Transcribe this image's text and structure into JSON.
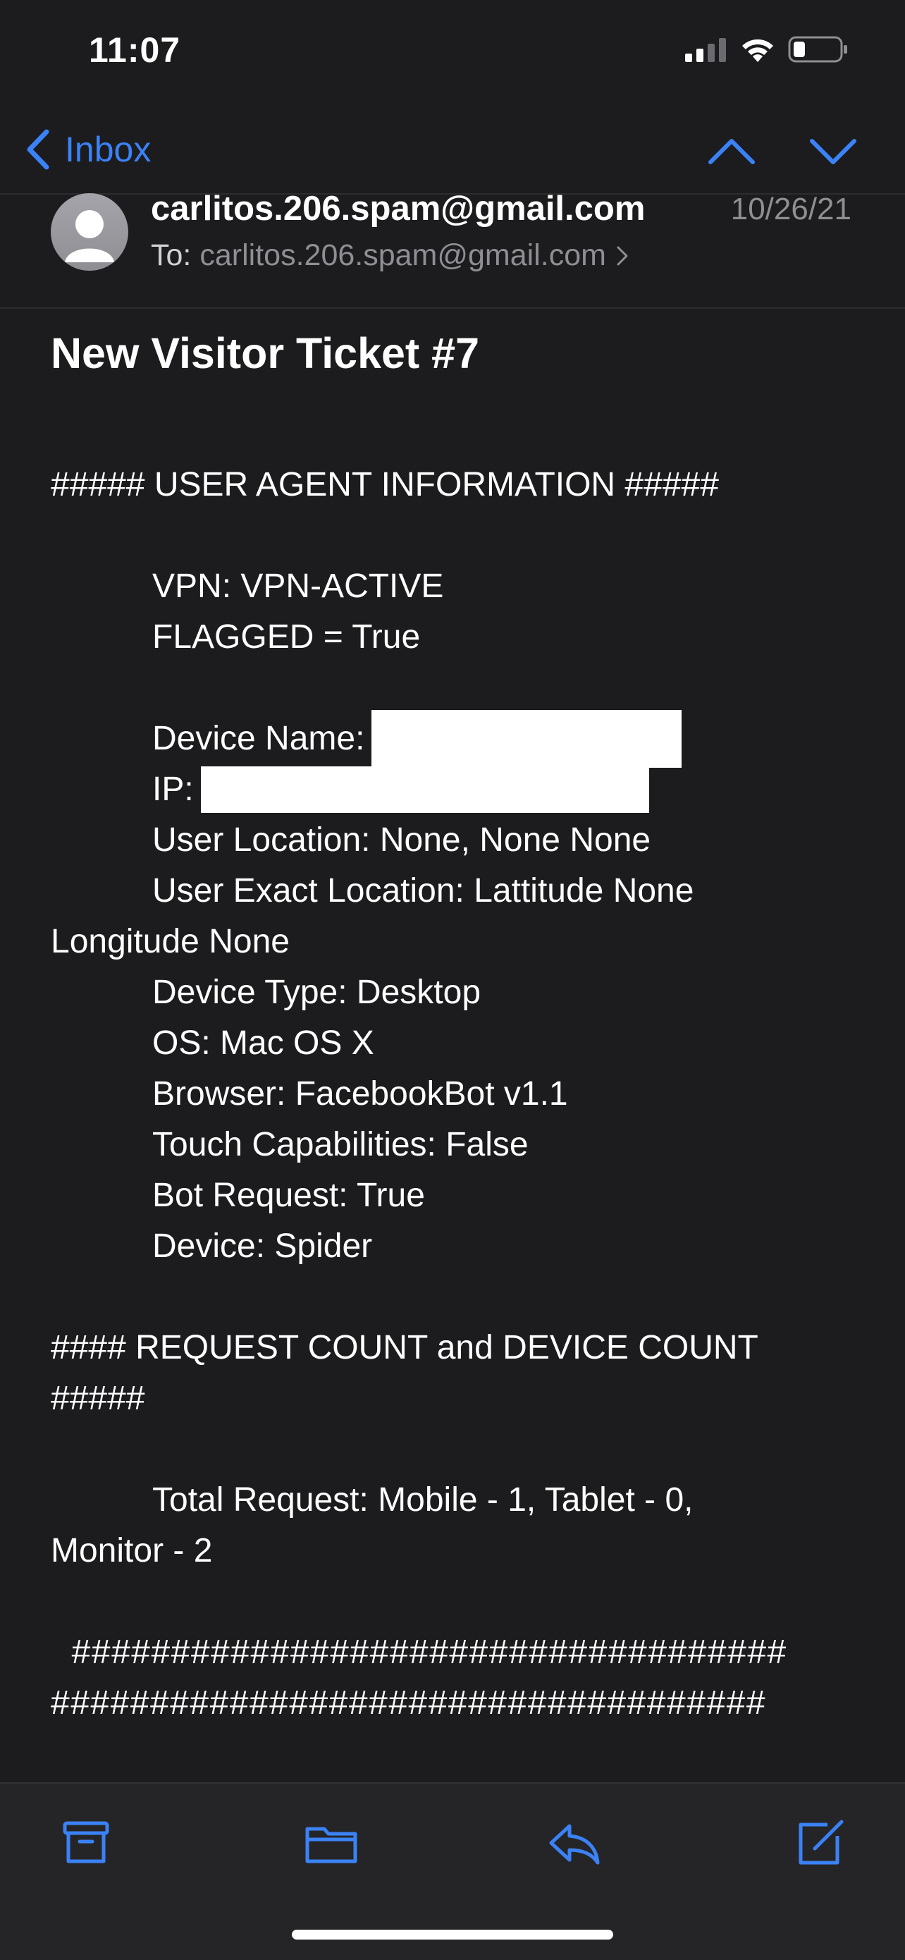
{
  "status_bar": {
    "time": "11:07",
    "signal_icon": "cellular-signal-icon",
    "wifi_icon": "wifi-icon",
    "battery_icon": "battery-low-icon"
  },
  "nav": {
    "back_label": "Inbox",
    "back_icon": "chevron-left-icon",
    "prev_icon": "chevron-up-icon",
    "next_icon": "chevron-down-icon"
  },
  "message": {
    "sender": "carlitos.206.spam@gmail.com",
    "date": "10/26/21",
    "to_label": "To:",
    "to_address": "carlitos.206.spam@gmail.com",
    "subject": "New Visitor Ticket #7"
  },
  "body": {
    "ua_header": "##### USER AGENT INFORMATION #####",
    "vpn": "VPN: VPN-ACTIVE",
    "flagged": "FLAGGED = True",
    "device_name_label": "Device Name:",
    "ip_label": "IP:",
    "user_location": "User Location: None, None None",
    "exact_location_1": "User Exact Location: Lattitude None",
    "exact_location_2": "Longitude None",
    "device_type": "Device Type: Desktop",
    "os": "OS: Mac OS X",
    "browser": "Browser: FacebookBot v1.1",
    "touch": "Touch Capabilities: False",
    "bot_request": "Bot Request: True",
    "device": "Device: Spider",
    "count_header_1": "#### REQUEST COUNT and DEVICE COUNT",
    "count_header_2": "#####",
    "total_request_1": "Total Request: Mobile - 1, Tablet - 0,",
    "total_request_2": "Monitor - 2",
    "hash_line_1": "  ####################################",
    "hash_line_2": "####################################"
  },
  "toolbar": {
    "archive_icon": "archive-icon",
    "folder_icon": "folder-icon",
    "reply_icon": "reply-icon",
    "compose_icon": "compose-icon"
  },
  "colors": {
    "background": "#1c1c1e",
    "accent": "#3b82f6",
    "secondary_text": "#8e8e93"
  }
}
